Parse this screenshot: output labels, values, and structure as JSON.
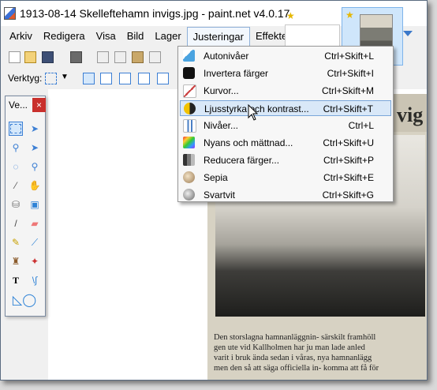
{
  "window": {
    "title": "1913-08-14 Skelleftehamn invigs.jpg - paint.net v4.0.17"
  },
  "menubar": {
    "items": [
      "Arkiv",
      "Redigera",
      "Visa",
      "Bild",
      "Lager",
      "Justeringar",
      "Effekter"
    ],
    "active": "Justeringar"
  },
  "toolbar": {
    "verktyg_label": "Verktyg:"
  },
  "tools_window": {
    "title": "Ve...",
    "close": "×"
  },
  "dropdown": {
    "items": [
      {
        "label": "Autonivåer",
        "shortcut": "Ctrl+Skift+L",
        "icon": "auto-level-icon"
      },
      {
        "label": "Invertera färger",
        "shortcut": "Ctrl+Skift+I",
        "icon": "invert-colors-icon"
      },
      {
        "label": "Kurvor...",
        "shortcut": "Ctrl+Skift+M",
        "icon": "curves-icon"
      },
      {
        "label": "Ljusstyrka och kontrast...",
        "shortcut": "Ctrl+Skift+T",
        "icon": "brightness-contrast-icon",
        "hovered": true
      },
      {
        "label": "Nivåer...",
        "shortcut": "Ctrl+L",
        "icon": "levels-icon"
      },
      {
        "label": "Nyans och mättnad...",
        "shortcut": "Ctrl+Skift+U",
        "icon": "hue-saturation-icon"
      },
      {
        "label": "Reducera färger...",
        "shortcut": "Ctrl+Skift+P",
        "icon": "posterize-icon"
      },
      {
        "label": "Sepia",
        "shortcut": "Ctrl+Skift+E",
        "icon": "sepia-icon"
      },
      {
        "label": "Svartvit",
        "shortcut": "Ctrl+Skift+G",
        "icon": "black-white-icon"
      }
    ]
  },
  "image": {
    "headline_fragment": "vig",
    "caption_lines": [
      "Den storslagna hamnanläggnin- särskilt framhöll",
      "gen ute vid Kallholmen har ju man lade anled",
      "varit i bruk ända sedan i våras, nya hamnanlägg",
      "men den så att säga officiella in- komma att få för"
    ]
  },
  "colors": {
    "accent": "#3b78c9",
    "menu_hover": "#d9e8f8",
    "close_red": "#c9302c"
  }
}
